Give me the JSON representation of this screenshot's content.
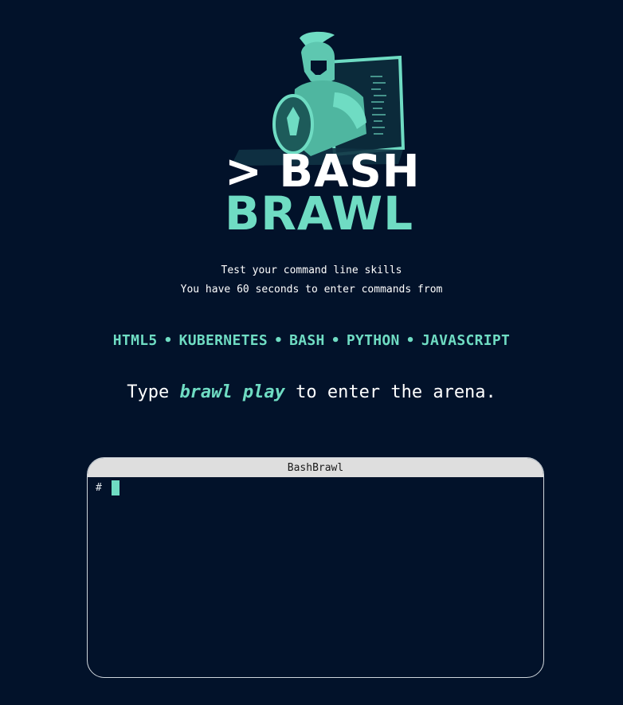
{
  "logo": {
    "line1": "> BASH",
    "line2": "BRAWL",
    "image": "spartan-warrior-laptop-logo"
  },
  "intro": {
    "tagline1": "Test your command line skills",
    "tagline2": "You have 60 seconds to enter commands from"
  },
  "categories": [
    "HTML5",
    "KUBERNETES",
    "BASH",
    "PYTHON",
    "JAVASCRIPT"
  ],
  "separator": "•",
  "instruction": {
    "prefix": "Type ",
    "command": "brawl play",
    "suffix": " to enter the arena."
  },
  "terminal": {
    "title": "BashBrawl",
    "prompt": "#",
    "input": ""
  },
  "colors": {
    "background": "#02122a",
    "accent": "#6fdcc3",
    "titlebar": "#dedede"
  }
}
